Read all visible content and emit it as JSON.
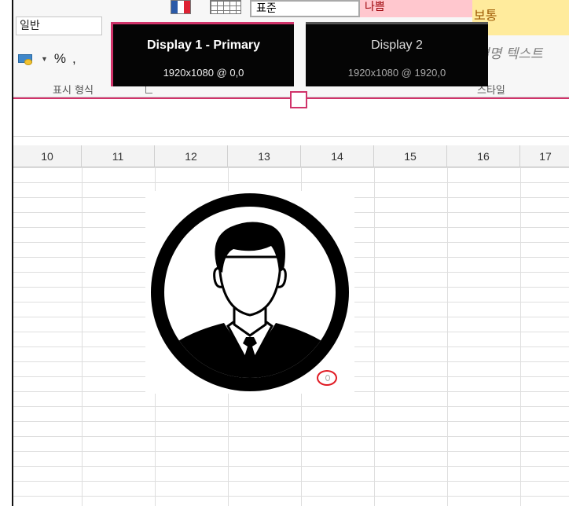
{
  "ribbon": {
    "number_format_value": "일반",
    "percent_label": "%",
    "comma_label": ",",
    "number_group_label": "표시 형식",
    "style_normal": "표준",
    "style_bad": "나쁨",
    "style_neutral": "보통",
    "style_explanatory": "설명 텍스트",
    "styles_group_label": "스타일"
  },
  "displays": [
    {
      "title": "Display 1 - Primary",
      "resolution": "1920x1080 @ 0,0"
    },
    {
      "title": "Display 2",
      "resolution": "1920x1080 @ 1920,0"
    }
  ],
  "columns": [
    "10",
    "11",
    "12",
    "13",
    "14",
    "15",
    "16",
    "17"
  ],
  "image": {
    "icon": "user-avatar-icon"
  },
  "colors": {
    "accent": "#d0336a",
    "handle_ring": "#e01b24"
  }
}
